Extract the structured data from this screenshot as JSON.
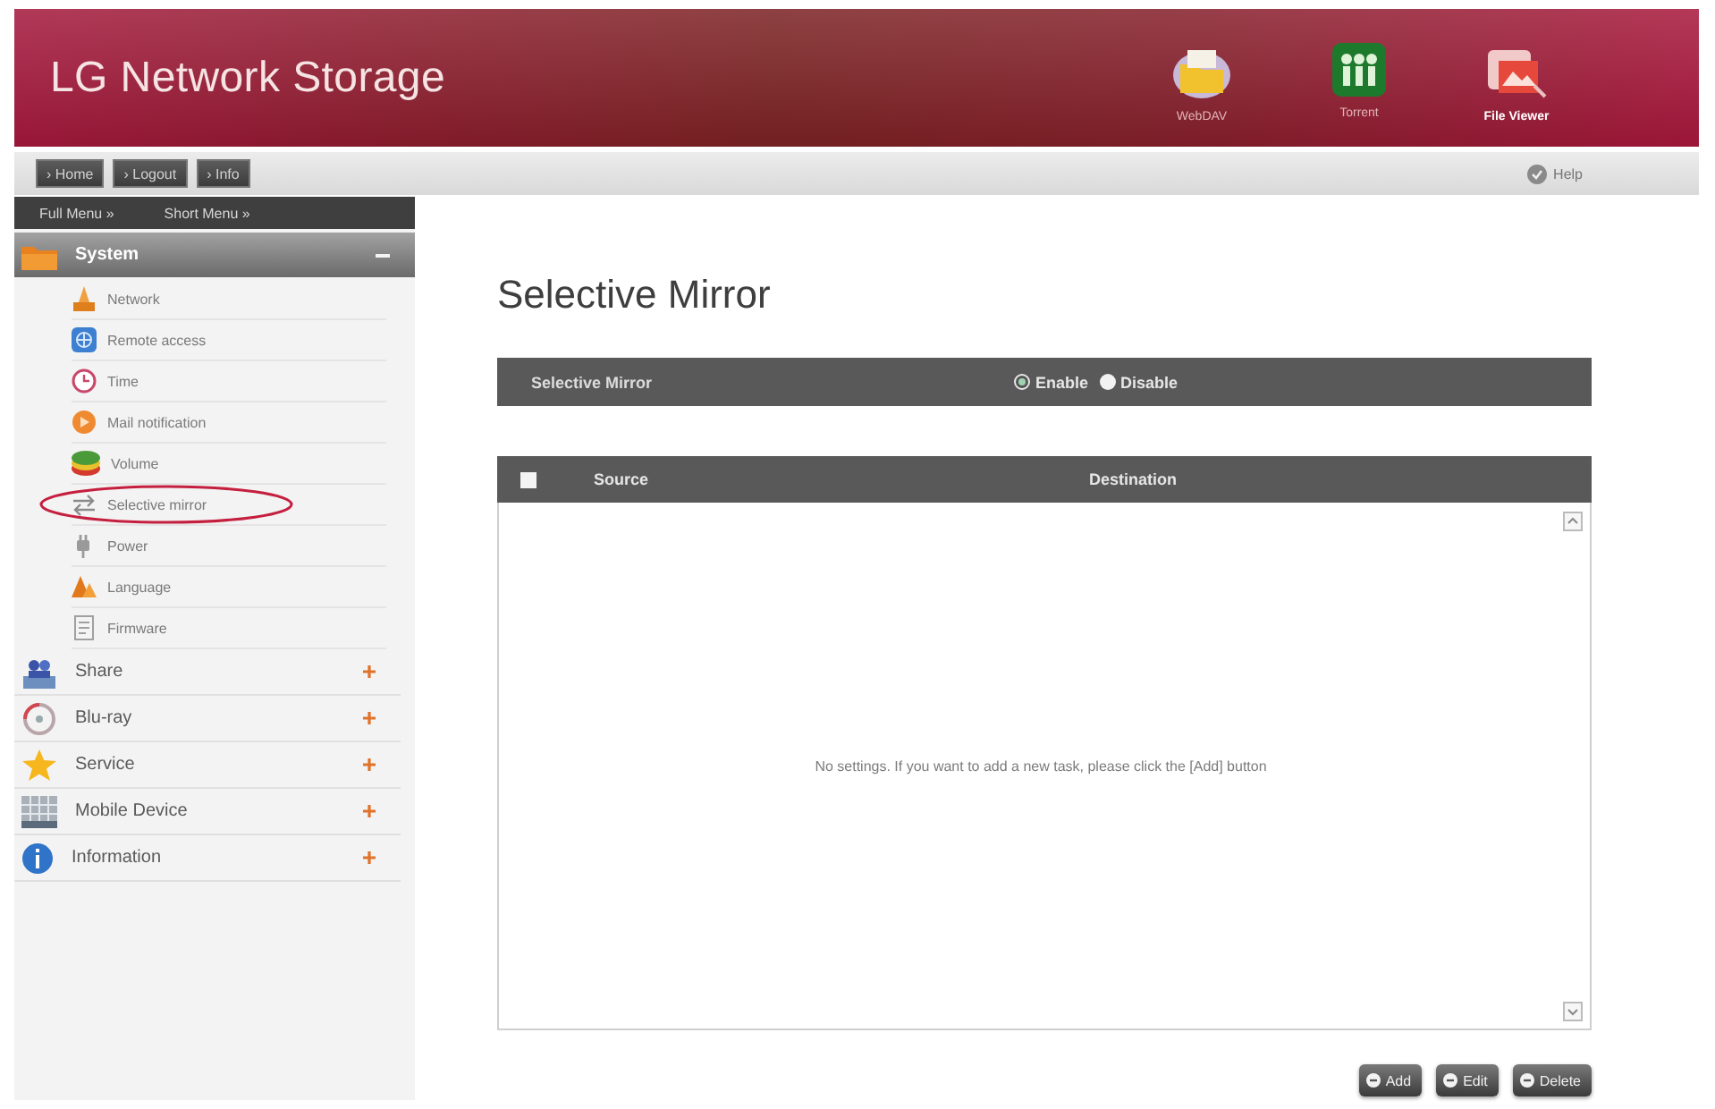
{
  "header": {
    "title": "LG Network Storage",
    "apps": [
      {
        "label": "WebDAV",
        "selected": false
      },
      {
        "label": "Torrent",
        "selected": false
      },
      {
        "label": "File Viewer",
        "selected": true
      }
    ]
  },
  "toolbar": {
    "links": [
      "› Home",
      "› Logout",
      "› Info"
    ],
    "help": "Help"
  },
  "sidebar": {
    "menus": [
      "Full Menu »",
      "Short Menu »"
    ],
    "groups": [
      {
        "label": "System",
        "expanded": true,
        "children": [
          {
            "label": "Network",
            "circled": false
          },
          {
            "label": "Remote access",
            "circled": false
          },
          {
            "label": "Time",
            "circled": false
          },
          {
            "label": "Mail notification",
            "circled": false
          },
          {
            "label": "Volume",
            "circled": false
          },
          {
            "label": "Selective mirror",
            "circled": true
          },
          {
            "label": "Power",
            "circled": false
          },
          {
            "label": "Language",
            "circled": false
          },
          {
            "label": "Firmware",
            "circled": false
          }
        ]
      },
      {
        "label": "Share",
        "expanded": false
      },
      {
        "label": "Blu-ray",
        "expanded": false
      },
      {
        "label": "Service",
        "expanded": false
      },
      {
        "label": "Mobile Device",
        "expanded": false
      },
      {
        "label": "Information",
        "expanded": false
      }
    ]
  },
  "main": {
    "title": "Selective Mirror",
    "setting": {
      "label": "Selective Mirror",
      "options": [
        {
          "label": "Enable",
          "selected": true
        },
        {
          "label": "Disable",
          "selected": false
        }
      ]
    },
    "table": {
      "checked": false,
      "columns": [
        "Source",
        "Destination"
      ],
      "empty_message": "No settings. If you want to add a new task, please click the [Add] button"
    },
    "buttons": [
      "Add",
      "Edit",
      "Delete"
    ]
  }
}
